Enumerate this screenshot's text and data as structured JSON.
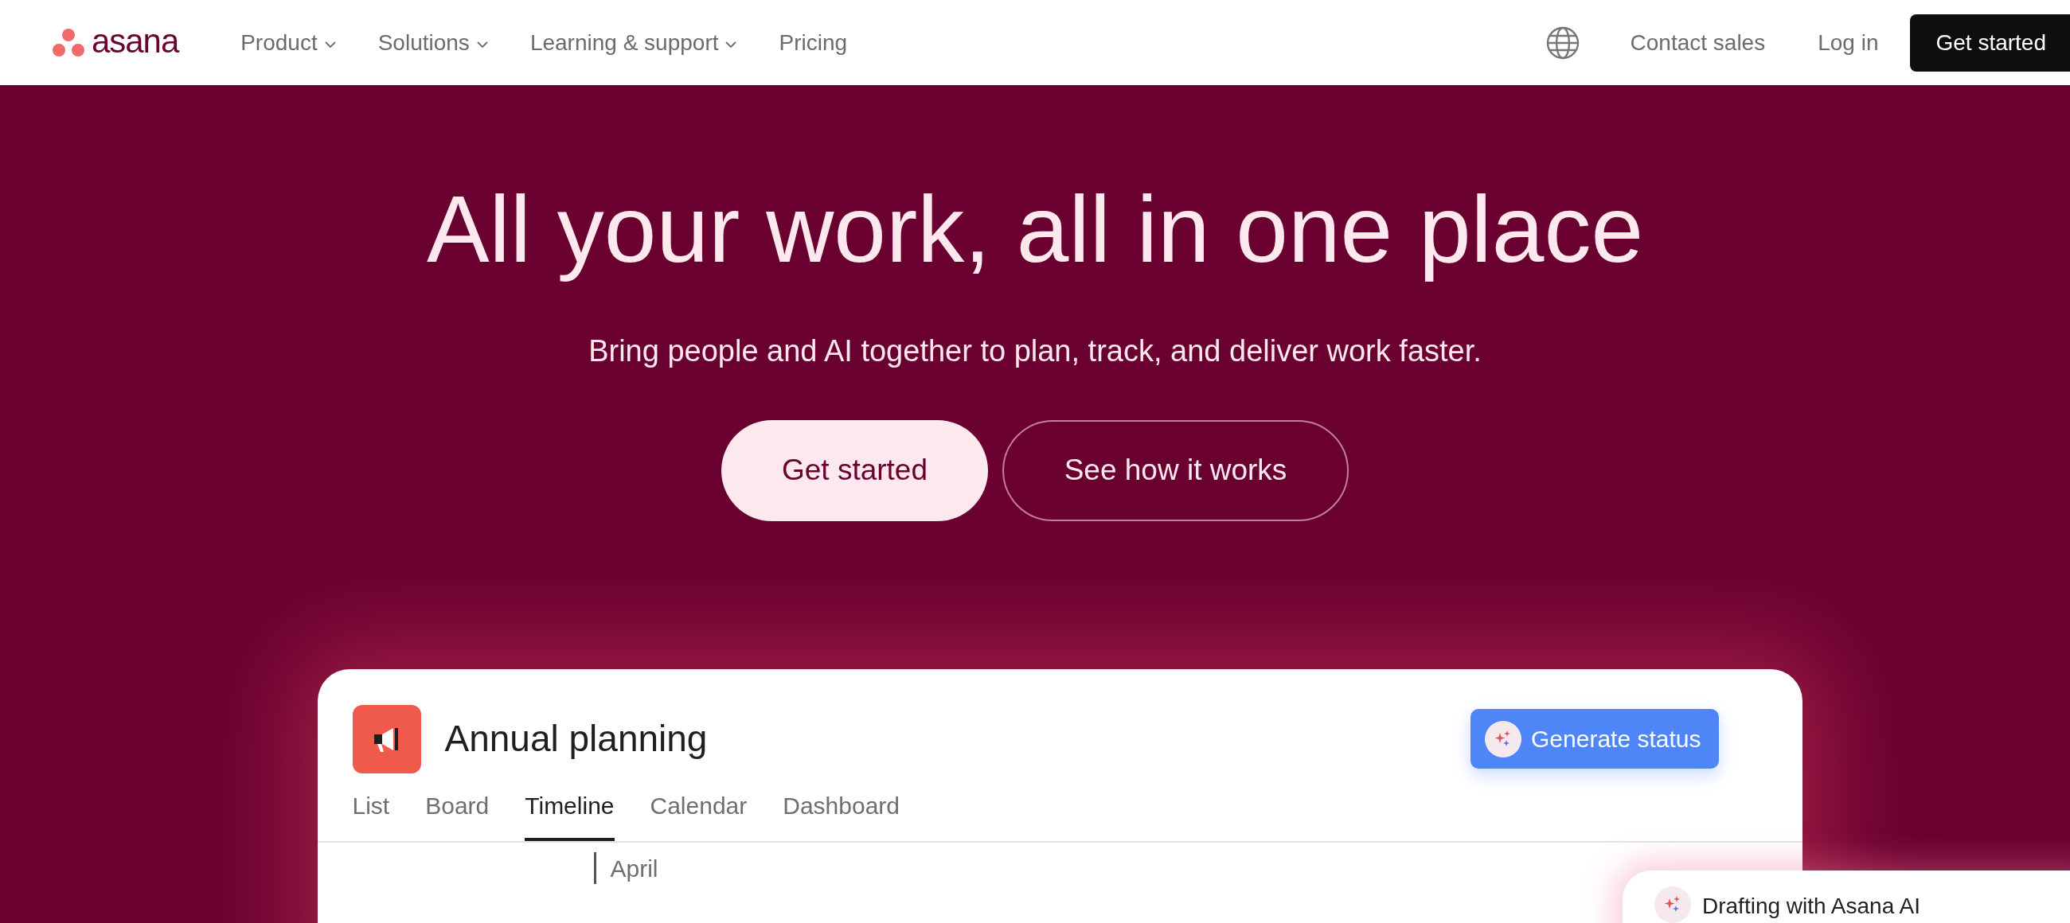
{
  "header": {
    "logo": "asana",
    "nav": [
      {
        "label": "Product",
        "dropdown": true
      },
      {
        "label": "Solutions",
        "dropdown": true
      },
      {
        "label": "Learning & support",
        "dropdown": true
      },
      {
        "label": "Pricing",
        "dropdown": false
      }
    ],
    "contact": "Contact sales",
    "login": "Log in",
    "cta": "Get started"
  },
  "hero": {
    "title": "All your work, all in one place",
    "subtitle": "Bring people and AI together to plan, track, and deliver work faster.",
    "primary": "Get started",
    "secondary": "See how it works"
  },
  "project": {
    "title": "Annual planning",
    "action": "Generate status",
    "tabs": [
      {
        "label": "List",
        "selected": false
      },
      {
        "label": "Board",
        "selected": false
      },
      {
        "label": "Timeline",
        "selected": true
      },
      {
        "label": "Calendar",
        "selected": false
      },
      {
        "label": "Dashboard",
        "selected": false
      }
    ],
    "month": "April"
  },
  "ai_card": {
    "title": "Drafting with Asana AI"
  }
}
